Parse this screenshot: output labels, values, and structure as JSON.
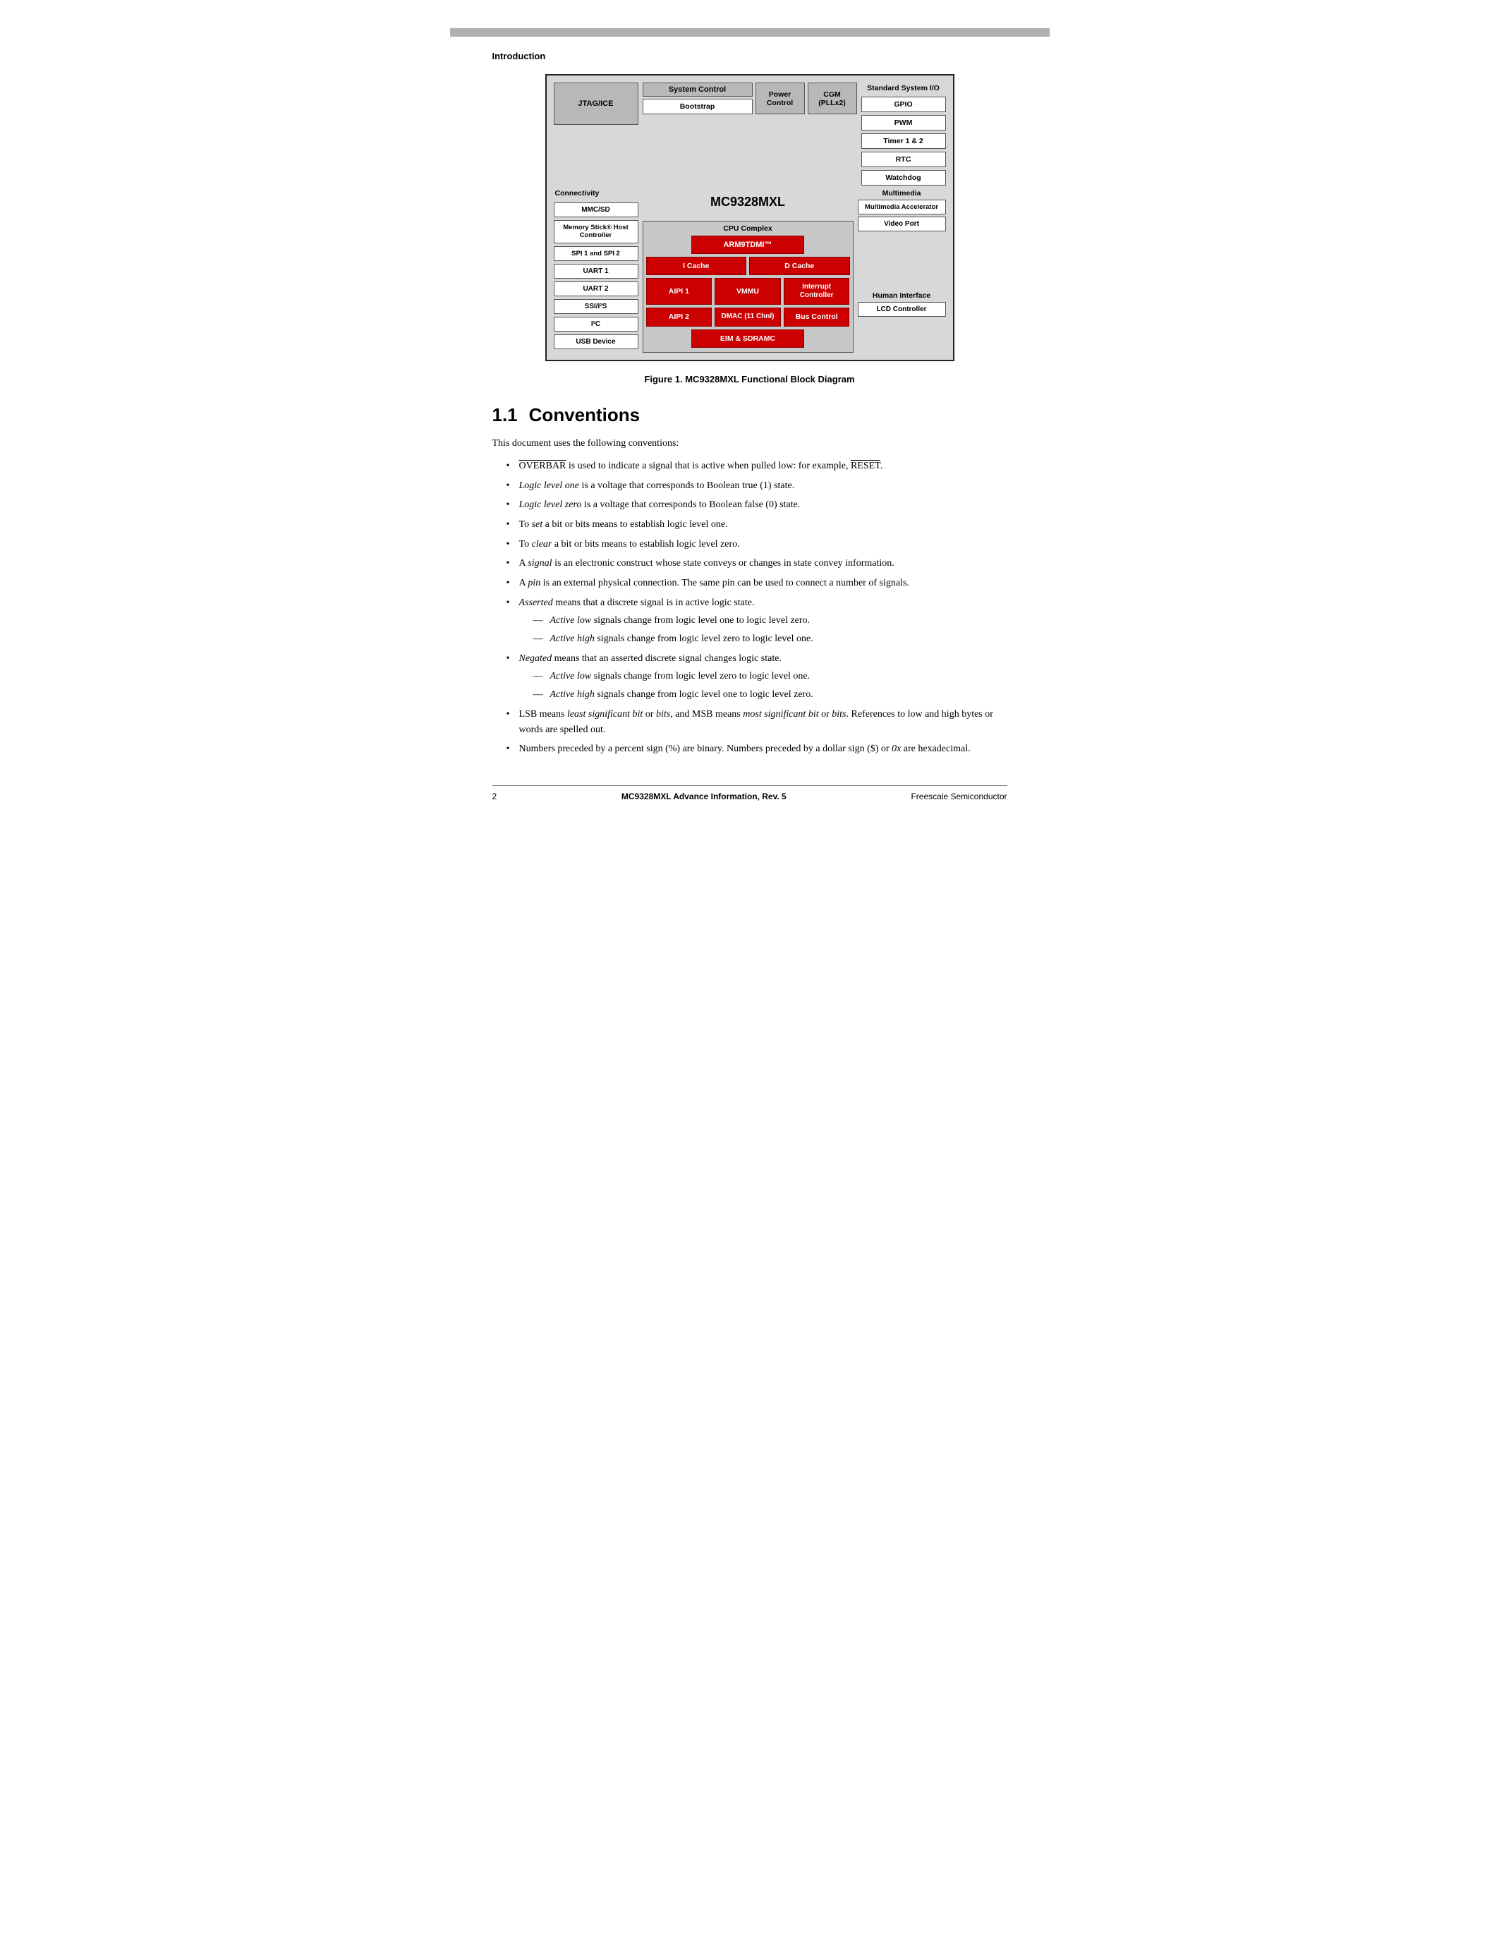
{
  "page": {
    "top_label": "Introduction",
    "figure_caption": "Figure 1.   MC9328MXL Functional Block Diagram",
    "section": {
      "number": "1.1",
      "title": "Conventions"
    },
    "footer": {
      "page_number": "2",
      "center_text": "MC9328MXL Advance Information, Rev. 5",
      "right_text": "Freescale Semiconductor"
    }
  },
  "diagram": {
    "chip_name": "MC9328MXL",
    "blocks": {
      "jtag": "JTAG/ICE",
      "system_control": "System Control",
      "bootstrap": "Bootstrap",
      "power_control": "Power Control",
      "cgm": "CGM (PLLx2)",
      "standard_sysio": "Standard System I/O",
      "gpio": "GPIO",
      "pwm": "PWM",
      "timer": "Timer 1 & 2",
      "rtc": "RTC",
      "watchdog": "Watchdog",
      "connectivity": "Connectivity",
      "mmc_sd": "MMC/SD",
      "memory_stick": "Memory Stick® Host Controller",
      "spi": "SPI 1 and SPI 2",
      "uart1": "UART 1",
      "uart2": "UART 2",
      "ssm": "SSI/I²S",
      "i2c": "I²C",
      "usb_device": "USB Device",
      "cpu_complex": "CPU Complex",
      "arm9": "ARM9TDMI™",
      "icache": "I Cache",
      "dcache": "D Cache",
      "aipi1": "AIPI 1",
      "vmmu": "VMMU",
      "interrupt_controller": "Interrupt Controller",
      "aipi2": "AIPI 2",
      "dmac": "DMAC (11 Chnl)",
      "bus_control": "Bus Control",
      "eim_sdramc": "EIM & SDRAMC",
      "multimedia": "Multimedia",
      "multimedia_accel": "Multimedia Accelerator",
      "video_port": "Video Port",
      "human_interface": "Human Interface",
      "lcd_controller": "LCD Controller"
    }
  },
  "conventions": {
    "intro": "This document uses the following conventions:",
    "bullets": [
      {
        "text_plain": " is used to indicate a signal that is active when pulled low: for example, ",
        "prefix_overbar": "OVERBAR",
        "suffix_overbar": "RESET",
        "suffix_plain": ".",
        "has_overbar": true
      }
    ],
    "items": [
      {
        "id": 1,
        "italic_part": "Logic level one",
        "rest": " is a voltage that corresponds to Boolean true (1) state."
      },
      {
        "id": 2,
        "italic_part": "Logic level zero",
        "rest": " is a voltage that corresponds to Boolean false (0) state."
      },
      {
        "id": 3,
        "plain_start": "To ",
        "italic_part": "set",
        "rest": " a bit or bits means to establish logic level one."
      },
      {
        "id": 4,
        "plain_start": "To ",
        "italic_part": "clear",
        "rest": " a bit or bits means to establish logic level zero."
      },
      {
        "id": 5,
        "plain_start": "A ",
        "italic_part": "signal",
        "rest": " is an electronic construct whose state conveys or changes in state convey information."
      },
      {
        "id": 6,
        "plain_start": "A ",
        "italic_part": "pin",
        "rest": " is an external physical connection. The same pin can be used to connect a number of signals."
      },
      {
        "id": 7,
        "italic_part": "Asserted",
        "rest": " means that a discrete signal is in active logic state.",
        "sub_items": [
          {
            "italic_part": "Active low",
            "rest": " signals change from logic level one to logic level zero."
          },
          {
            "italic_part": "Active high",
            "rest": " signals change from logic level zero to logic level one."
          }
        ]
      },
      {
        "id": 8,
        "italic_part": "Negated",
        "rest": " means that an asserted discrete signal changes logic state.",
        "sub_items": [
          {
            "italic_part": "Active low",
            "rest": " signals change from logic level zero to logic level one."
          },
          {
            "italic_part": "Active high",
            "rest": " signals change from logic level one to logic level zero."
          }
        ]
      },
      {
        "id": 9,
        "plain_start": "LSB means ",
        "italic1": "least significant bit",
        "mid1": " or ",
        "italic2": "bits",
        "mid2": ", and MSB means ",
        "italic3": "most significant bit",
        "mid3": " or ",
        "italic4": "bits",
        "rest": ". References to low and high bytes or words are spelled out.",
        "type": "lsb_msb"
      },
      {
        "id": 10,
        "plain": "Numbers preceded by a percent sign (%) are binary. Numbers preceded by a dollar sign ($) or ",
        "italic_inline": "0x",
        "rest": " are hexadecimal.",
        "type": "numbers"
      }
    ]
  }
}
